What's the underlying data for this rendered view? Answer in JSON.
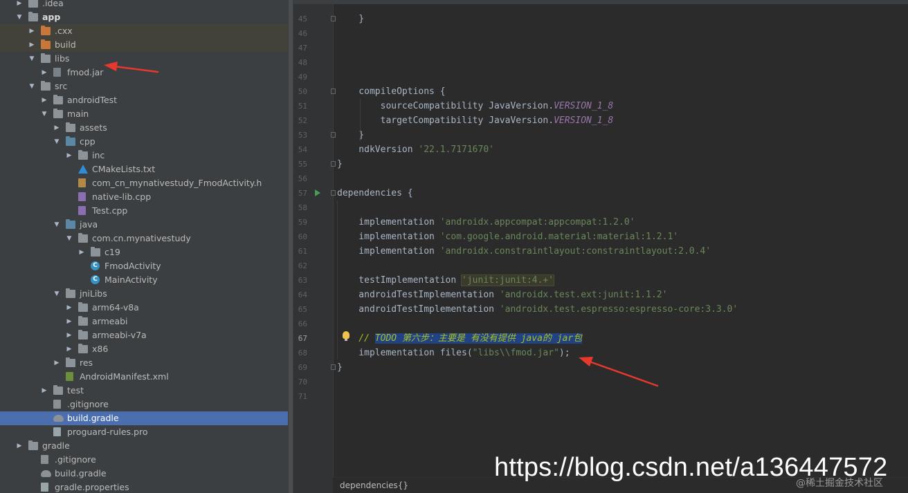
{
  "colors": {
    "tree_bg": "#3c3f41",
    "editor_bg": "#2b2b2b",
    "selection": "#4b6eaf",
    "arrow_red": "#e8382e"
  },
  "tree": [
    {
      "label": ".idea",
      "depth": 0,
      "kind": "folder-gray",
      "arrow": "right"
    },
    {
      "label": "app",
      "depth": 0,
      "kind": "folder-module",
      "arrow": "down",
      "bold": true
    },
    {
      "label": ".cxx",
      "depth": 1,
      "kind": "folder-orange",
      "arrow": "right",
      "band": true
    },
    {
      "label": "build",
      "depth": 1,
      "kind": "folder-orange",
      "arrow": "right",
      "band": true
    },
    {
      "label": "libs",
      "depth": 1,
      "kind": "folder-gray",
      "arrow": "down"
    },
    {
      "label": "fmod.jar",
      "depth": 2,
      "kind": "jar",
      "arrow": "right"
    },
    {
      "label": "src",
      "depth": 1,
      "kind": "folder-gray",
      "arrow": "down"
    },
    {
      "label": "androidTest",
      "depth": 2,
      "kind": "folder-gray",
      "arrow": "right"
    },
    {
      "label": "main",
      "depth": 2,
      "kind": "folder-gray",
      "arrow": "down"
    },
    {
      "label": "assets",
      "depth": 3,
      "kind": "folder-gray",
      "arrow": "right"
    },
    {
      "label": "cpp",
      "depth": 3,
      "kind": "folder-blue",
      "arrow": "down"
    },
    {
      "label": "inc",
      "depth": 4,
      "kind": "folder-gray",
      "arrow": "right"
    },
    {
      "label": "CMakeLists.txt",
      "depth": 4,
      "kind": "cmake",
      "arrow": ""
    },
    {
      "label": "com_cn_mynativestudy_FmodActivity.h",
      "depth": 4,
      "kind": "h",
      "arrow": ""
    },
    {
      "label": "native-lib.cpp",
      "depth": 4,
      "kind": "cpp",
      "arrow": ""
    },
    {
      "label": "Test.cpp",
      "depth": 4,
      "kind": "cpp",
      "arrow": ""
    },
    {
      "label": "java",
      "depth": 3,
      "kind": "folder-blue",
      "arrow": "down"
    },
    {
      "label": "com.cn.mynativestudy",
      "depth": 4,
      "kind": "folder-gray",
      "arrow": "down"
    },
    {
      "label": "c19",
      "depth": 5,
      "kind": "folder-gray",
      "arrow": "right"
    },
    {
      "label": "FmodActivity",
      "depth": 5,
      "kind": "class",
      "arrow": ""
    },
    {
      "label": "MainActivity",
      "depth": 5,
      "kind": "class",
      "arrow": ""
    },
    {
      "label": "jniLibs",
      "depth": 3,
      "kind": "folder-gray",
      "arrow": "down"
    },
    {
      "label": "arm64-v8a",
      "depth": 4,
      "kind": "folder-gray",
      "arrow": "right"
    },
    {
      "label": "armeabi",
      "depth": 4,
      "kind": "folder-gray",
      "arrow": "right"
    },
    {
      "label": "armeabi-v7a",
      "depth": 4,
      "kind": "folder-gray",
      "arrow": "right"
    },
    {
      "label": "x86",
      "depth": 4,
      "kind": "folder-gray",
      "arrow": "right"
    },
    {
      "label": "res",
      "depth": 3,
      "kind": "folder-gray",
      "arrow": "right"
    },
    {
      "label": "AndroidManifest.xml",
      "depth": 3,
      "kind": "manifest",
      "arrow": ""
    },
    {
      "label": "test",
      "depth": 2,
      "kind": "folder-gray",
      "arrow": "right"
    },
    {
      "label": ".gitignore",
      "depth": 2,
      "kind": "git",
      "arrow": ""
    },
    {
      "label": "build.gradle",
      "depth": 2,
      "kind": "gradle",
      "arrow": "",
      "selected": true
    },
    {
      "label": "proguard-rules.pro",
      "depth": 2,
      "kind": "file",
      "arrow": ""
    },
    {
      "label": "gradle",
      "depth": 0,
      "kind": "folder-gray",
      "arrow": "right"
    },
    {
      "label": ".gitignore",
      "depth": 1,
      "kind": "git",
      "arrow": ""
    },
    {
      "label": "build.gradle",
      "depth": 1,
      "kind": "gradle",
      "arrow": ""
    },
    {
      "label": "gradle.properties",
      "depth": 1,
      "kind": "file",
      "arrow": ""
    }
  ],
  "editor": {
    "current_line": "67",
    "lines": [
      {
        "n": "45",
        "parts": [
          {
            "t": "    }",
            "c": ""
          }
        ]
      },
      {
        "n": "46",
        "parts": []
      },
      {
        "n": "47",
        "parts": []
      },
      {
        "n": "48",
        "parts": []
      },
      {
        "n": "49",
        "parts": []
      },
      {
        "n": "50",
        "parts": [
          {
            "t": "    compileOptions {",
            "c": ""
          }
        ]
      },
      {
        "n": "51",
        "parts": [
          {
            "t": "        sourceCompatibility JavaVersion.",
            "c": ""
          },
          {
            "t": "VERSION_1_8",
            "c": "italic-purple"
          }
        ]
      },
      {
        "n": "52",
        "parts": [
          {
            "t": "        targetCompatibility JavaVersion.",
            "c": ""
          },
          {
            "t": "VERSION_1_8",
            "c": "italic-purple"
          }
        ]
      },
      {
        "n": "53",
        "parts": [
          {
            "t": "    }",
            "c": ""
          }
        ]
      },
      {
        "n": "54",
        "parts": [
          {
            "t": "    ndkVersion ",
            "c": ""
          },
          {
            "t": "'22.1.7171670'",
            "c": "str"
          }
        ]
      },
      {
        "n": "55",
        "parts": [
          {
            "t": "}",
            "c": ""
          }
        ]
      },
      {
        "n": "56",
        "parts": []
      },
      {
        "n": "57",
        "parts": [
          {
            "t": "dependencies {",
            "c": ""
          }
        ]
      },
      {
        "n": "58",
        "parts": []
      },
      {
        "n": "59",
        "parts": [
          {
            "t": "    implementation ",
            "c": ""
          },
          {
            "t": "'androidx.appcompat:appcompat:1.2.0'",
            "c": "str"
          }
        ]
      },
      {
        "n": "60",
        "parts": [
          {
            "t": "    implementation ",
            "c": ""
          },
          {
            "t": "'com.google.android.material:material:1.2.1'",
            "c": "str"
          }
        ]
      },
      {
        "n": "61",
        "parts": [
          {
            "t": "    implementation ",
            "c": ""
          },
          {
            "t": "'androidx.constraintlayout:constraintlayout:2.0.4'",
            "c": "str"
          }
        ]
      },
      {
        "n": "62",
        "parts": []
      },
      {
        "n": "63",
        "parts": [
          {
            "t": "    testImplementation ",
            "c": ""
          },
          {
            "t": "'junit:junit:4.+'",
            "c": "str hl-yellow"
          }
        ]
      },
      {
        "n": "64",
        "parts": [
          {
            "t": "    androidTestImplementation ",
            "c": ""
          },
          {
            "t": "'androidx.test.ext:junit:1.1.2'",
            "c": "str"
          }
        ]
      },
      {
        "n": "65",
        "parts": [
          {
            "t": "    androidTestImplementation ",
            "c": ""
          },
          {
            "t": "'androidx.test.espresso:espresso-core:3.3.0'",
            "c": "str"
          }
        ]
      },
      {
        "n": "66",
        "parts": []
      },
      {
        "n": "67",
        "parts": [
          {
            "t": "    // ",
            "c": "todo"
          },
          {
            "t": "TODO 第六步：主要是 有没有提供 java的 jar包",
            "c": "todo hl-select"
          }
        ]
      },
      {
        "n": "68",
        "parts": [
          {
            "t": "    implementation files(",
            "c": ""
          },
          {
            "t": "\"libs\\\\fmod.jar\"",
            "c": "str"
          },
          {
            "t": ");",
            "c": ""
          }
        ]
      },
      {
        "n": "69",
        "parts": [
          {
            "t": "}",
            "c": ""
          }
        ]
      },
      {
        "n": "70",
        "parts": []
      },
      {
        "n": "71",
        "parts": []
      }
    ]
  },
  "breadcrumb": "dependencies{}",
  "watermark": "https://blog.csdn.net/a136447572",
  "watermark_secondary": "@稀土掘金技术社区"
}
